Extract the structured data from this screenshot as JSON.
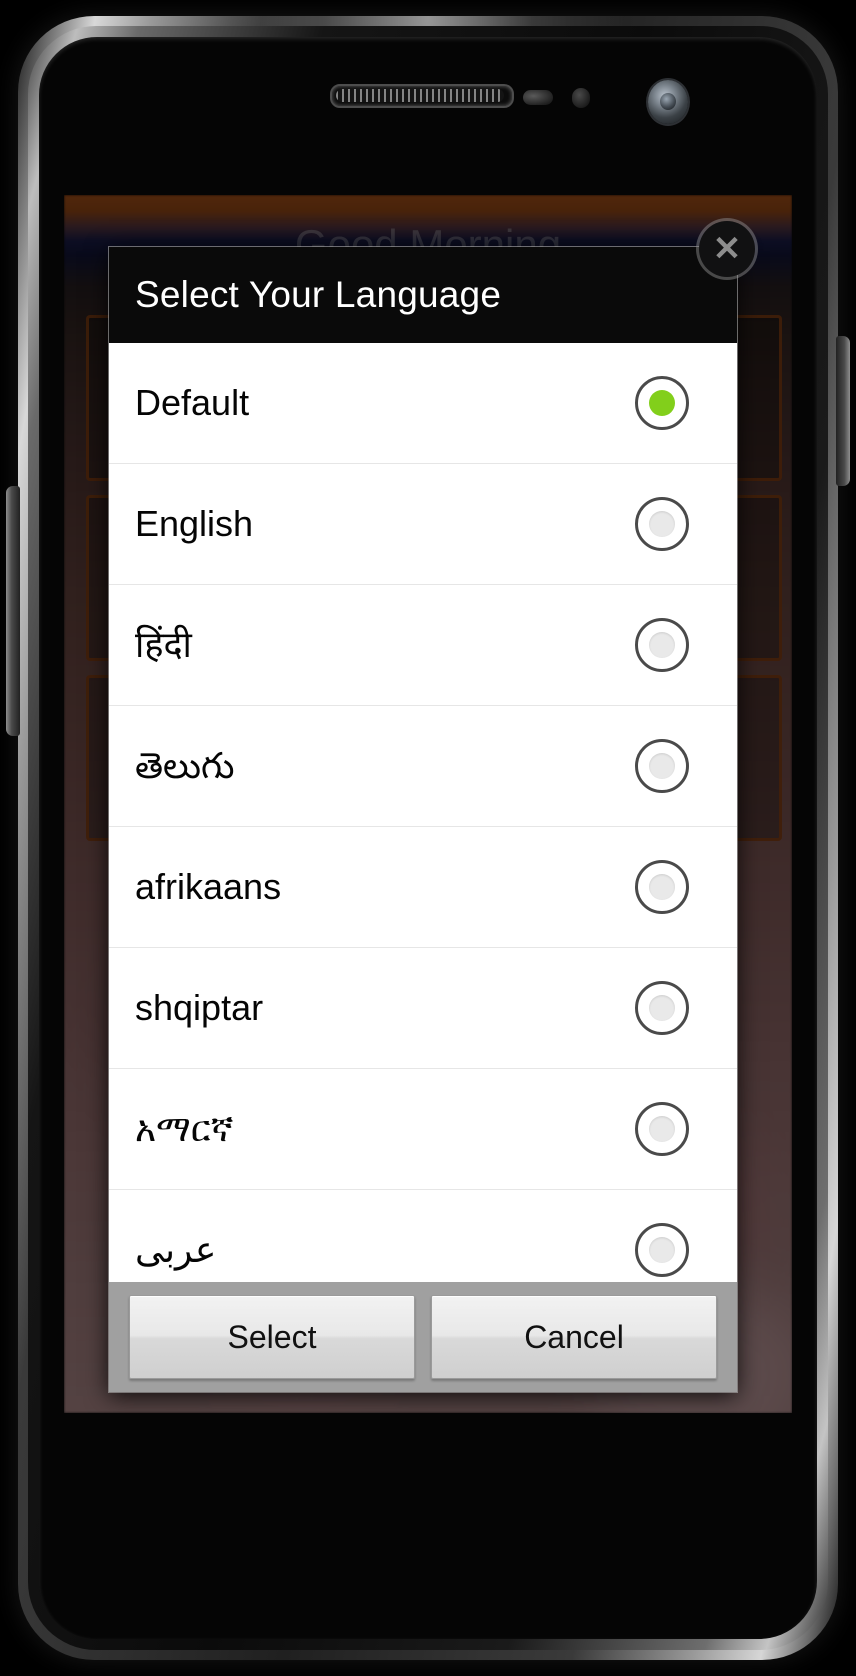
{
  "device": {
    "hardware": {
      "earpiece": "earpiece-speaker",
      "camera": "front-camera",
      "proximity_sensor": "proximity-sensor",
      "light_sensor": "light-sensor"
    }
  },
  "background_app": {
    "greeting": "Good Morning"
  },
  "dialog": {
    "title": "Select Your Language",
    "close_label": "✕",
    "languages": [
      {
        "label": "Default",
        "selected": true,
        "rtl": false
      },
      {
        "label": "English",
        "selected": false,
        "rtl": false
      },
      {
        "label": "हिंदी",
        "selected": false,
        "rtl": false
      },
      {
        "label": "తెలుగు",
        "selected": false,
        "rtl": false
      },
      {
        "label": "afrikaans",
        "selected": false,
        "rtl": false
      },
      {
        "label": "shqiptar",
        "selected": false,
        "rtl": false
      },
      {
        "label": "አማርኛ",
        "selected": false,
        "rtl": false
      },
      {
        "label": "عربی",
        "selected": false,
        "rtl": true
      }
    ],
    "buttons": {
      "select_label": "Select",
      "cancel_label": "Cancel"
    }
  },
  "colors": {
    "accent_green": "#82cf1b",
    "title_bar": "#0a0a0a",
    "list_bg": "#ffffff",
    "button_bar": "#a0a0a0",
    "radio_ring": "#4a4a4a"
  }
}
